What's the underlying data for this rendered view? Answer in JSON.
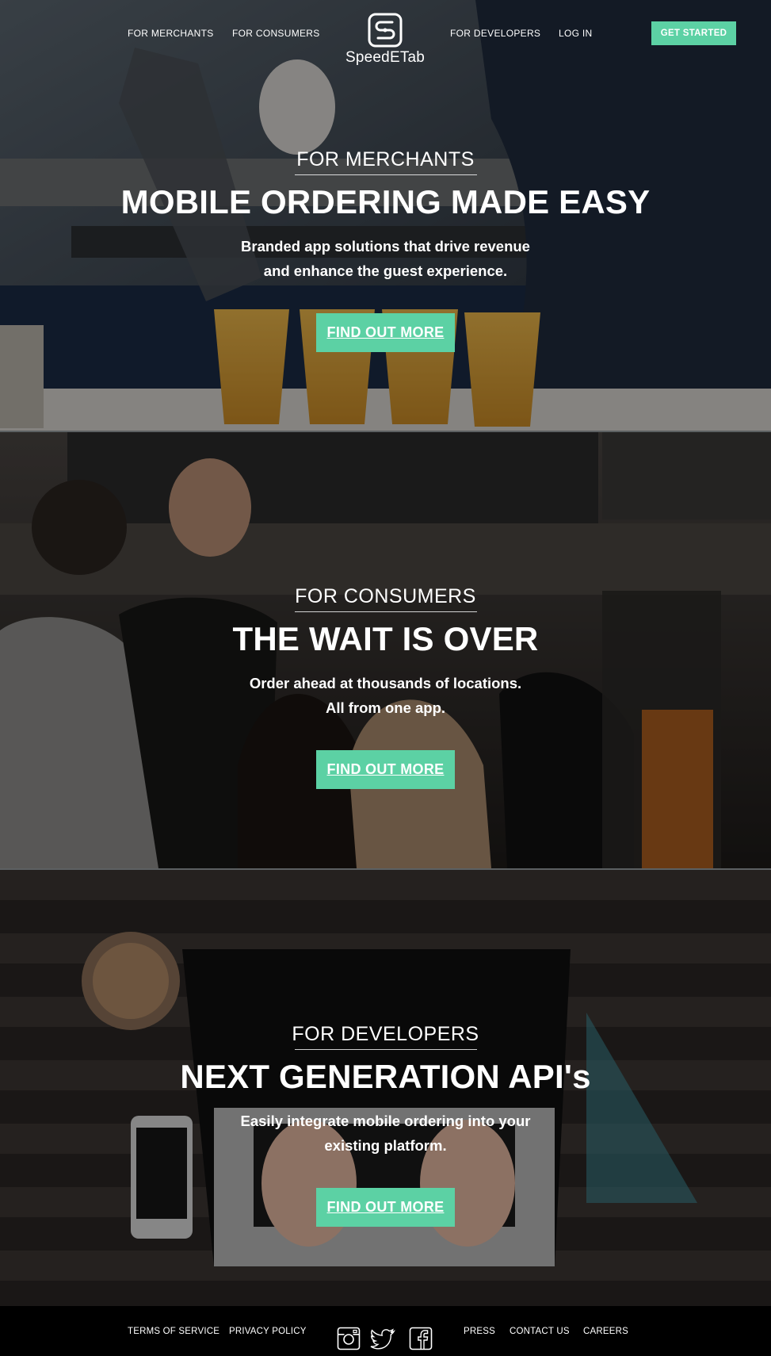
{
  "nav": {
    "for_merchants": "FOR MERCHANTS",
    "for_consumers": "FOR CONSUMERS",
    "logo_text": "SpeedETab",
    "for_developers": "FOR DEVELOPERS",
    "log_in": "LOG IN",
    "get_started": "GET STARTED"
  },
  "sections": [
    {
      "eyebrow": "FOR MERCHANTS",
      "headline": "MOBILE ORDERING MADE EASY",
      "sub_line1": "Branded app solutions that drive revenue",
      "sub_line2": "and enhance the guest experience.",
      "cta": "FIND OUT MORE"
    },
    {
      "eyebrow": "FOR CONSUMERS",
      "headline": "THE WAIT IS OVER",
      "sub_line1": "Order ahead at thousands of locations.",
      "sub_line2": "All from one app.",
      "cta": "FIND OUT MORE"
    },
    {
      "eyebrow": "FOR DEVELOPERS",
      "headline": "NEXT GENERATION API's",
      "sub_line1": "Easily integrate mobile ordering into your",
      "sub_line2": "existing platform.",
      "cta": "FIND OUT MORE"
    }
  ],
  "footer": {
    "terms": "TERMS OF SERVICE",
    "privacy": "PRIVACY POLICY",
    "press": "PRESS",
    "contact": "CONTACT US",
    "careers": "CAREERS",
    "social_icons": [
      "instagram-icon",
      "twitter-icon",
      "facebook-icon"
    ]
  },
  "colors": {
    "accent": "#5cd1a4",
    "footer_bg": "#000000"
  }
}
